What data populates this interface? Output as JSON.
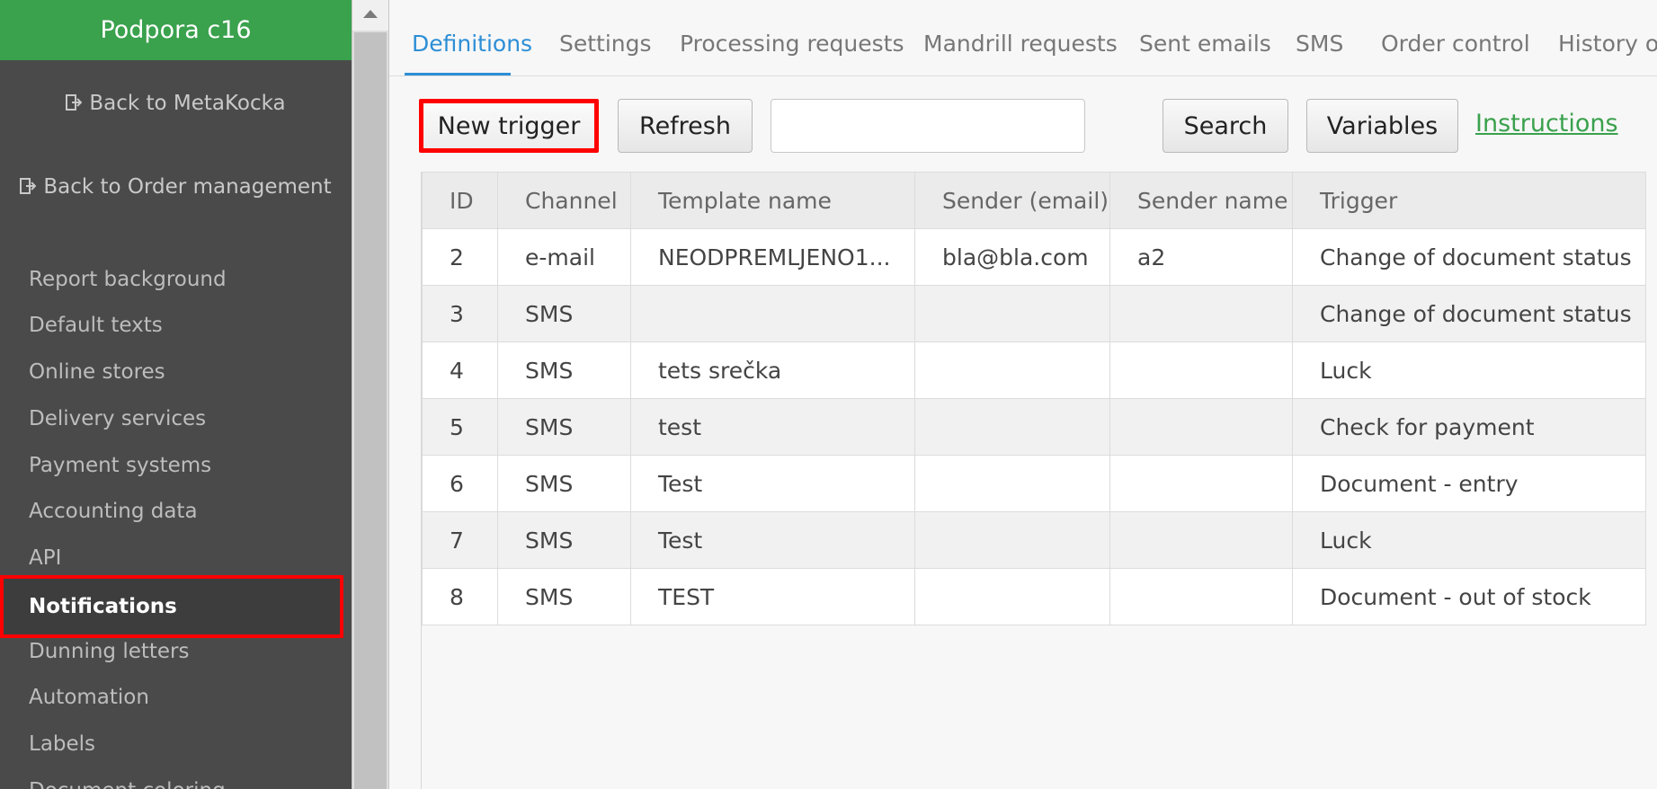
{
  "sidebar": {
    "brand": "Podpora c16",
    "back_metakocka": "Back to MetaKocka",
    "back_order_mgmt": "Back to Order management",
    "items": [
      {
        "label": "Report background"
      },
      {
        "label": "Default texts"
      },
      {
        "label": "Online stores"
      },
      {
        "label": "Delivery services"
      },
      {
        "label": "Payment systems"
      },
      {
        "label": "Accounting data"
      },
      {
        "label": "API"
      },
      {
        "label": "Notifications"
      },
      {
        "label": "Dunning letters"
      },
      {
        "label": "Automation"
      },
      {
        "label": "Labels"
      },
      {
        "label": "Document coloring"
      }
    ]
  },
  "tabs": [
    {
      "label": "Definitions"
    },
    {
      "label": "Settings"
    },
    {
      "label": "Processing requests"
    },
    {
      "label": "Mandrill requests"
    },
    {
      "label": "Sent emails"
    },
    {
      "label": "SMS"
    },
    {
      "label": "Order control"
    },
    {
      "label": "History of"
    }
  ],
  "toolbar": {
    "new_trigger": "New trigger",
    "refresh": "Refresh",
    "search_value": "",
    "search": "Search",
    "variables": "Variables",
    "instructions": "Instructions"
  },
  "table": {
    "headers": {
      "id": "ID",
      "channel": "Channel",
      "template": "Template name",
      "sender_email": "Sender (email)",
      "sender_name": "Sender name",
      "trigger": "Trigger"
    },
    "rows": [
      {
        "id": "2",
        "channel": "e-mail",
        "template": "NEODPREMLJENO1...",
        "sender_email": "bla@bla.com",
        "sender_name": "a2",
        "trigger": "Change of document status"
      },
      {
        "id": "3",
        "channel": "SMS",
        "template": "",
        "sender_email": "",
        "sender_name": "",
        "trigger": "Change of document status"
      },
      {
        "id": "4",
        "channel": "SMS",
        "template": "tets srečka",
        "sender_email": "",
        "sender_name": "",
        "trigger": "Luck"
      },
      {
        "id": "5",
        "channel": "SMS",
        "template": "test",
        "sender_email": "",
        "sender_name": "",
        "trigger": "Check for payment"
      },
      {
        "id": "6",
        "channel": "SMS",
        "template": "Test",
        "sender_email": "",
        "sender_name": "",
        "trigger": "Document - entry"
      },
      {
        "id": "7",
        "channel": "SMS",
        "template": "Test",
        "sender_email": "",
        "sender_name": "",
        "trigger": "Luck"
      },
      {
        "id": "8",
        "channel": "SMS",
        "template": "TEST",
        "sender_email": "",
        "sender_name": "",
        "trigger": "Document - out of stock"
      }
    ]
  }
}
